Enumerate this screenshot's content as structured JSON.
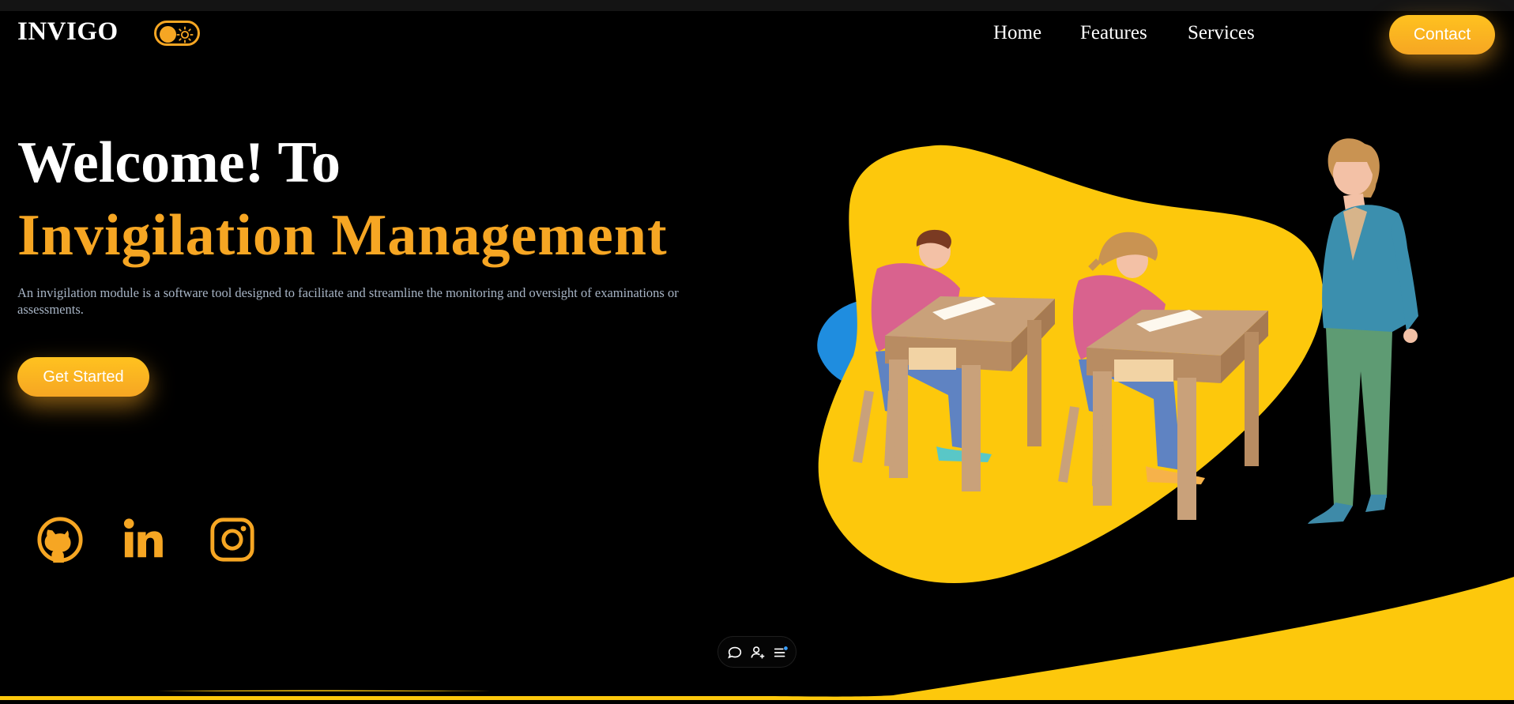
{
  "brand": {
    "logo_text": "INVIGO"
  },
  "nav": {
    "links": [
      "Home",
      "Features",
      "Services"
    ],
    "contact_label": "Contact"
  },
  "hero": {
    "title_line1": "Welcome! To",
    "title_line2": "Invigilation Management",
    "description": "An invigilation module is a software tool designed to facilitate and streamline the monitoring and oversight of examinations or assessments.",
    "cta_label": "Get Started"
  },
  "social": [
    "github-icon",
    "linkedin-icon",
    "instagram-icon"
  ],
  "theme_toggle": {
    "icon": "sun-icon",
    "state": "light"
  },
  "dock": {
    "icons": [
      "chat-bubble-icon",
      "add-user-icon",
      "list-icon"
    ]
  },
  "colors": {
    "accent": "#f6a623",
    "accent_light": "#ffc21f",
    "blob": "#fdc80c",
    "background": "#000000",
    "description_text": "#a7b4c5"
  }
}
